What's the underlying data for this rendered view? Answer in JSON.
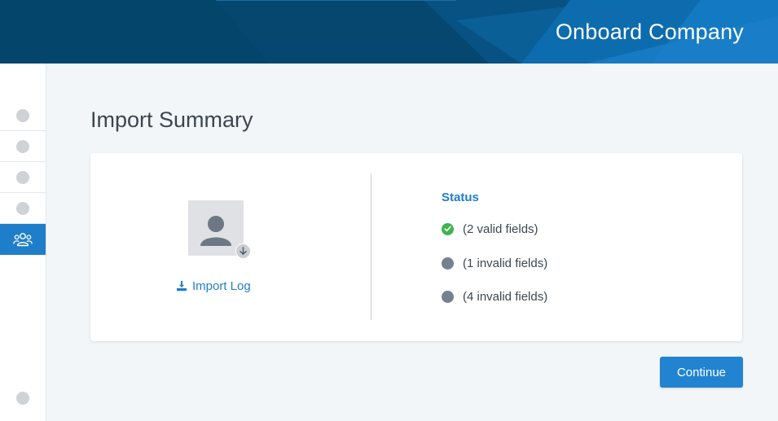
{
  "header": {
    "title": "Onboard Company"
  },
  "sidebar": {
    "steps": [
      {
        "icon": "step-dot",
        "state": "incomplete"
      },
      {
        "icon": "step-dot",
        "state": "incomplete"
      },
      {
        "icon": "step-dot",
        "state": "incomplete"
      },
      {
        "icon": "step-dot",
        "state": "incomplete"
      },
      {
        "icon": "users-icon",
        "state": "active"
      }
    ],
    "bottom_icon": "step-dot"
  },
  "page": {
    "title": "Import Summary"
  },
  "import": {
    "avatar_icon": "person-icon",
    "badge_icon": "download-arrow-icon",
    "log_label": "Import Log",
    "log_icon": "download-icon"
  },
  "status": {
    "heading": "Status",
    "items": [
      {
        "text": "(2 valid fields)",
        "state": "valid",
        "color": "#3eb34f"
      },
      {
        "text": "(1 invalid fields)",
        "state": "invalid",
        "color": "#748190"
      },
      {
        "text": "(4 invalid fields)",
        "state": "invalid",
        "color": "#748190"
      }
    ]
  },
  "actions": {
    "continue_label": "Continue"
  },
  "colors": {
    "brand": "#04456c",
    "accent": "#1f7ec9",
    "button": "#2284d1",
    "valid": "#3eb34f",
    "muted": "#748190"
  }
}
